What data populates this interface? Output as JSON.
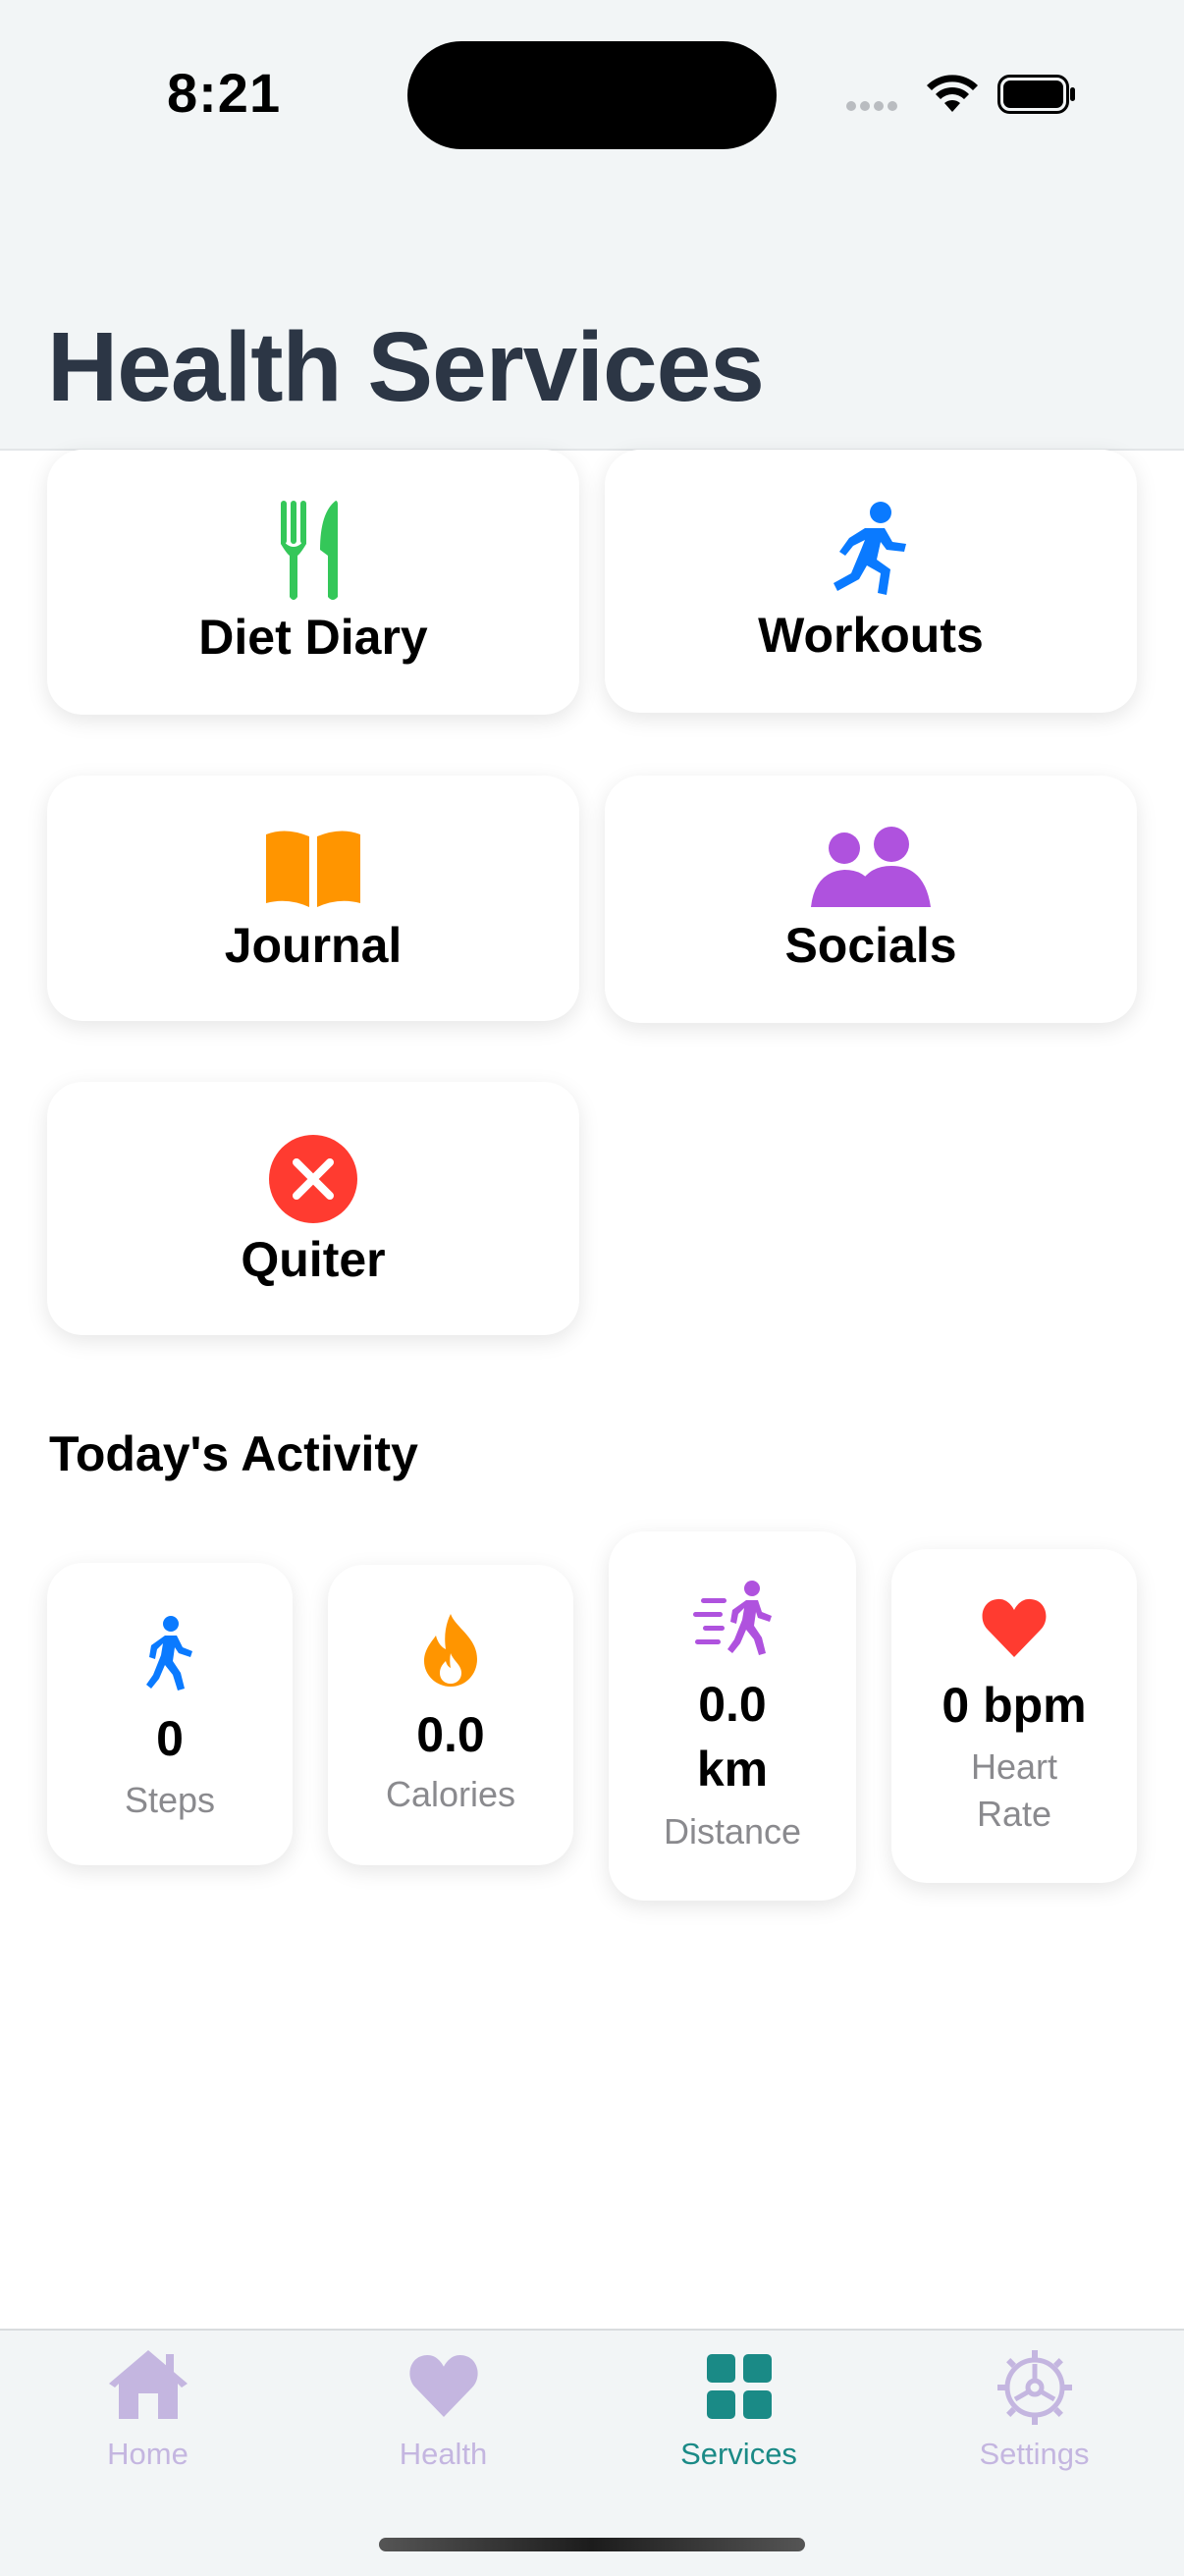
{
  "status": {
    "time": "8:21"
  },
  "header": {
    "title": "Health Services"
  },
  "services": [
    {
      "label": "Diet Diary",
      "icon": "fork-knife-icon",
      "color": "#34c759"
    },
    {
      "label": "Workouts",
      "icon": "running-figure-icon",
      "color": "#0a7aff"
    },
    {
      "label": "Journal",
      "icon": "book-icon",
      "color": "#ff9500"
    },
    {
      "label": "Socials",
      "icon": "people-icon",
      "color": "#af52de"
    },
    {
      "label": "Quiter",
      "icon": "x-circle-icon",
      "color": "#ff3b30"
    }
  ],
  "activity": {
    "title": "Today's Activity",
    "stats": [
      {
        "value": "0",
        "caption": "Steps",
        "icon": "walking-figure-icon",
        "color": "#0a7aff"
      },
      {
        "value": "0.0",
        "caption": "Calories",
        "icon": "flame-icon",
        "color": "#ff9500"
      },
      {
        "value_line1": "0.0",
        "value_line2": "km",
        "caption": "Distance",
        "icon": "walking-motion-icon",
        "color": "#af52de"
      },
      {
        "value": "0 bpm",
        "caption_line1": "Heart",
        "caption_line2": "Rate",
        "icon": "heart-icon",
        "color": "#ff3b30"
      }
    ]
  },
  "tabbar": {
    "items": [
      {
        "label": "Home",
        "icon": "house-icon",
        "active": false
      },
      {
        "label": "Health",
        "icon": "heart-icon",
        "active": false
      },
      {
        "label": "Services",
        "icon": "grid-icon",
        "active": true
      },
      {
        "label": "Settings",
        "icon": "gear-icon",
        "active": false
      }
    ],
    "active_color": "#1a8a86",
    "inactive_color": "#c4b6e0"
  }
}
